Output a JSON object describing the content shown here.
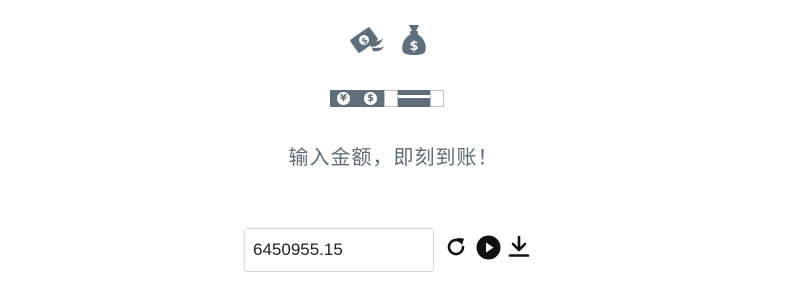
{
  "icons": {
    "top": [
      "money-with-wings-icon",
      "money-bag-icon"
    ],
    "payment_methods": [
      "yen-coin-icon",
      "dollar-coin-icon",
      "blank-slot",
      "credit-card-icon",
      "blank-slot"
    ],
    "actions": [
      "refresh-icon",
      "play-circle-icon",
      "download-icon"
    ]
  },
  "payment": {
    "yen_symbol": "¥",
    "dollar_symbol": "$"
  },
  "tagline": "输入金额，即刻到账！",
  "amount": {
    "value": "6450955.15"
  },
  "colors": {
    "icon": "#5e6e7b",
    "text": "#5f6c78",
    "action_icon": "#111111",
    "input_border": "#d5d9dd"
  }
}
